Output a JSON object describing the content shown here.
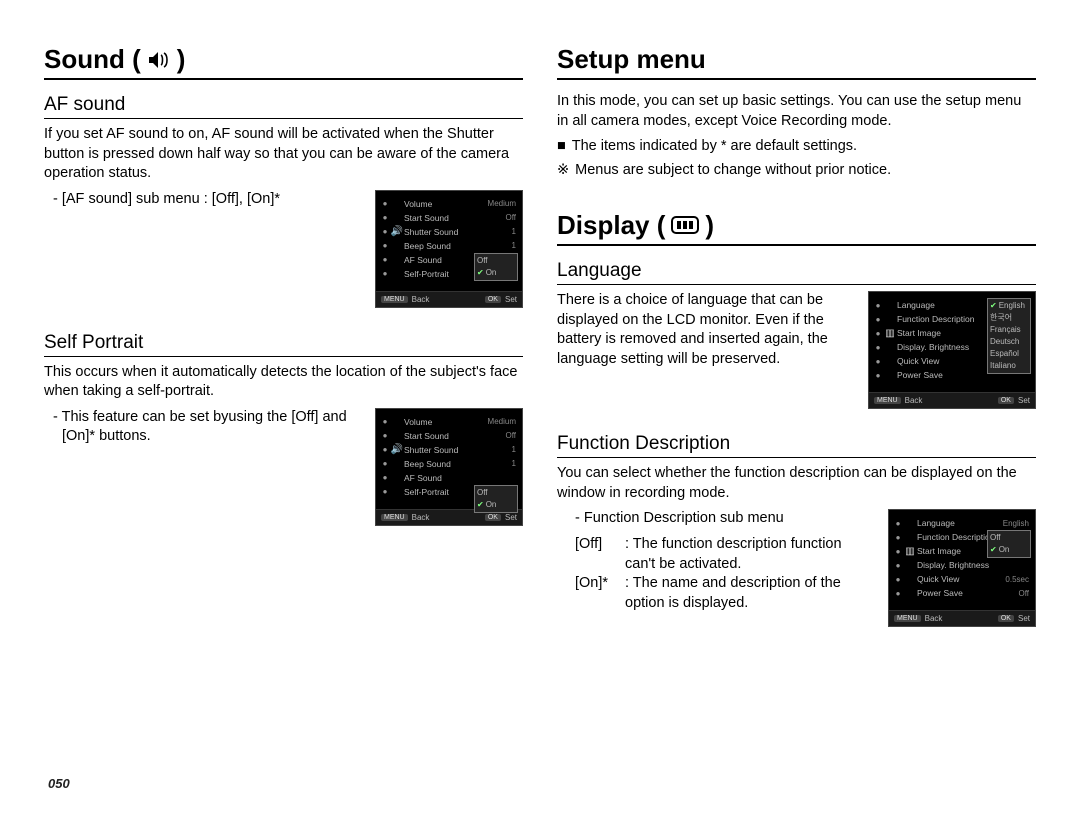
{
  "pageNumber": "050",
  "left": {
    "h1": "Sound (",
    "h1_close": " )",
    "af": {
      "h2": "AF sound",
      "p1": "If you set AF sound to on, AF sound will be activated when the Shutter button is pressed down half way so that you can be aware of the camera operation status.",
      "sub": "- [AF sound] sub menu : [Off], [On]*",
      "menu": {
        "items": [
          {
            "label": "Volume",
            "val": "Medium"
          },
          {
            "label": "Start Sound",
            "val": "Off"
          },
          {
            "label": "Shutter Sound",
            "val": "1"
          },
          {
            "label": "Beep Sound",
            "val": "1"
          },
          {
            "label": "AF Sound",
            "val": ""
          },
          {
            "label": "Self-Portrait",
            "val": ""
          }
        ],
        "popupTop": 62,
        "popup": [
          "Off",
          "On"
        ],
        "popupSelIdx": 1,
        "footBack": "Back",
        "footSet": "Set"
      }
    },
    "sp": {
      "h2": "Self Portrait",
      "p1": "This occurs when it automatically detects the location of the subject's face when taking a self-portrait.",
      "sub": "- This feature can be set byusing the [Off] and [On]* buttons.",
      "menu": {
        "items": [
          {
            "label": "Volume",
            "val": "Medium"
          },
          {
            "label": "Start Sound",
            "val": "Off"
          },
          {
            "label": "Shutter Sound",
            "val": "1"
          },
          {
            "label": "Beep Sound",
            "val": "1"
          },
          {
            "label": "AF Sound",
            "val": ""
          },
          {
            "label": "Self-Portrait",
            "val": ""
          }
        ],
        "popupTop": 76,
        "popup": [
          "Off",
          "On"
        ],
        "popupSelIdx": 1,
        "footBack": "Back",
        "footSet": "Set"
      }
    }
  },
  "right": {
    "setup": {
      "h1": "Setup menu",
      "p1": "In this mode, you can set up basic settings. You can use the setup menu in all camera modes, except Voice Recording mode.",
      "b1": "The items indicated by * are default settings.",
      "b2": "Menus are subject to change without prior notice.",
      "sym1": "■",
      "sym2": "※"
    },
    "display": {
      "h1": "Display (",
      "h1_close": " )"
    },
    "lang": {
      "h2": "Language",
      "p1": "There is a choice of language that can be displayed on the LCD monitor. Even if the battery is removed and inserted again, the language setting will be preserved.",
      "menu": {
        "items": [
          {
            "label": "Language",
            "val": ""
          },
          {
            "label": "Function Description",
            "val": ""
          },
          {
            "label": "Start Image",
            "val": ""
          },
          {
            "label": "Display. Brightness",
            "val": ""
          },
          {
            "label": "Quick View",
            "val": ""
          },
          {
            "label": "Power Save",
            "val": ""
          }
        ],
        "popupTop": 6,
        "popup": [
          "English",
          "한국어",
          "Français",
          "Deutsch",
          "Español",
          "Italiano"
        ],
        "popupSelIdx": 0,
        "footBack": "Back",
        "footSet": "Set"
      }
    },
    "fd": {
      "h2": "Function Description",
      "p1": "You can select whether the function description can be displayed on the window in recording mode.",
      "subHead": "- Function Description sub menu",
      "offKey": "[Off]",
      "offVal": ": The function description function can't be activated.",
      "onKey": "[On]*",
      "onVal": ": The name and description of the option is displayed.",
      "menu": {
        "items": [
          {
            "label": "Language",
            "val": "English"
          },
          {
            "label": "Function Description",
            "val": ""
          },
          {
            "label": "Start Image",
            "val": ""
          },
          {
            "label": "Display. Brightness",
            "val": ""
          },
          {
            "label": "Quick View",
            "val": "0.5sec"
          },
          {
            "label": "Power Save",
            "val": "Off"
          }
        ],
        "popupTop": 20,
        "popup": [
          "Off",
          "On"
        ],
        "popupSelIdx": 1,
        "footBack": "Back",
        "footSet": "Set"
      }
    }
  }
}
